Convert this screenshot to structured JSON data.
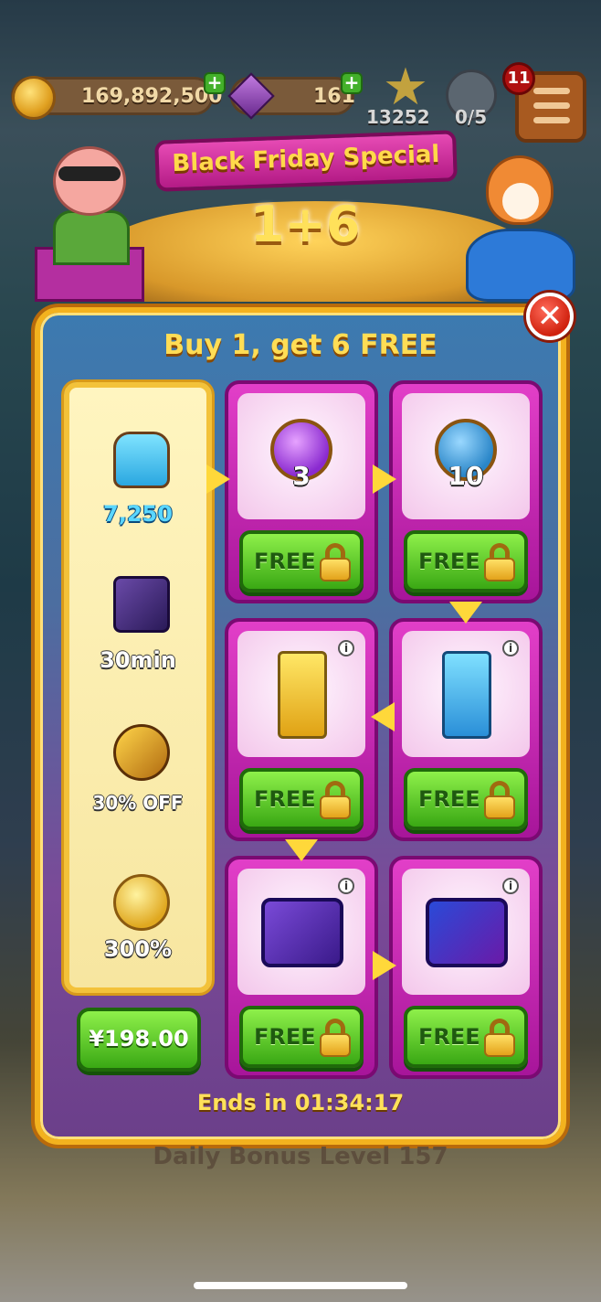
{
  "hud": {
    "coins": "169,892,500",
    "gems": "161",
    "stars": "13252",
    "shields": "0/5",
    "notification_count": "11"
  },
  "banner": {
    "title": "Black Friday Special",
    "deal": "1+6"
  },
  "offer": {
    "headline": "Buy 1, get 6 FREE",
    "paid_items": [
      {
        "icon": "gloves-icon",
        "label": "7,250"
      },
      {
        "icon": "hammer-icon",
        "label": "30min"
      },
      {
        "icon": "golden-hammer-icon",
        "label": "30% OFF"
      },
      {
        "icon": "potion-icon",
        "label": "300%"
      }
    ],
    "price": "¥198.00",
    "free_label": "FREE",
    "free_items": [
      {
        "icon": "energy-token-icon",
        "count": "3"
      },
      {
        "icon": "crown-token-icon",
        "count": "10"
      },
      {
        "icon": "golden-card-pack-icon",
        "count": ""
      },
      {
        "icon": "blue-card-pack-icon",
        "count": ""
      },
      {
        "icon": "purple-chest-icon",
        "count": ""
      },
      {
        "icon": "neon-chest-icon",
        "count": ""
      }
    ],
    "timer": "Ends in 01:34:17"
  },
  "footer": {
    "daily_bonus": "Daily Bonus Level 157"
  },
  "colors": {
    "gold": "#f3b21e",
    "green": "#3aa814",
    "magenta": "#d12fb8"
  }
}
